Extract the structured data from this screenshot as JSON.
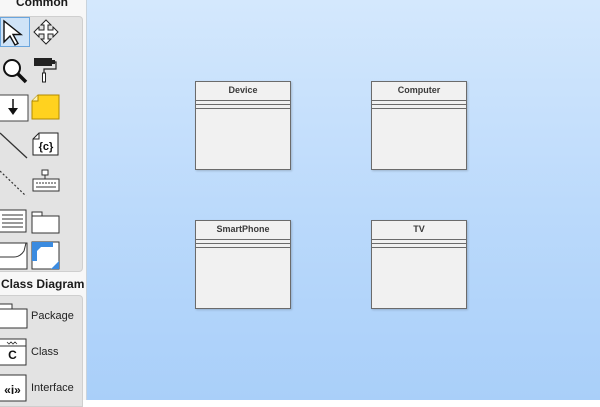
{
  "palette": {
    "common_header": "Common",
    "class_diagram_header": "Class Diagram",
    "tools": [
      {
        "icon": "select-arrow-icon",
        "selected": true
      },
      {
        "icon": "move-arrows-icon"
      },
      {
        "icon": "zoom-icon"
      },
      {
        "icon": "format-painter-icon"
      },
      {
        "icon": "anchor-arrow-icon"
      },
      {
        "icon": "note-icon"
      },
      {
        "icon": "line-icon"
      },
      {
        "icon": "constraint-icon",
        "text": "{c}"
      },
      {
        "icon": "dashed-line-icon"
      },
      {
        "icon": "keyboard-icon"
      },
      {
        "icon": "list-icon"
      },
      {
        "icon": "folder-icon"
      },
      {
        "icon": "frame-icon"
      },
      {
        "icon": "blue-note-icon"
      }
    ],
    "class_items": [
      {
        "label": "Package"
      },
      {
        "label": "Class",
        "icon_text": "C"
      },
      {
        "label": "Interface",
        "icon_text": "«i»"
      }
    ]
  },
  "canvas": {
    "classes": [
      {
        "name": "Device"
      },
      {
        "name": "Computer"
      },
      {
        "name": "SmartPhone"
      },
      {
        "name": "TV"
      }
    ]
  }
}
